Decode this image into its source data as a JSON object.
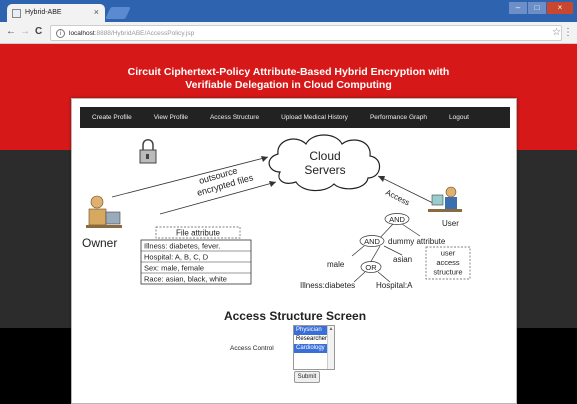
{
  "browser": {
    "tab_title": "Hybrid-ABE",
    "tab_close": "×",
    "url_host": "localhost",
    "url_rest": ":8888/HybridABE/AccessPolicy.jsp",
    "back": "←",
    "forward": "→",
    "reload": "C",
    "info": "i",
    "star": "☆",
    "menu": "⋮",
    "window_buttons": {
      "minimize": "–",
      "maximize": "□",
      "close": "×"
    }
  },
  "header": {
    "title_line1": "Circuit Ciphertext-Policy Attribute-Based Hybrid Encryption with",
    "title_line2": "Verifiable Delegation in Cloud Computing"
  },
  "nav": {
    "items": [
      "Create Profile",
      "View Profile",
      "Access Structure",
      "Upload Medical History",
      "Performance Graph",
      "Logout"
    ]
  },
  "diagram": {
    "cloud_line1": "Cloud",
    "cloud_line2": "Servers",
    "outsource_line1": "outsource",
    "outsource_line2": "encrypted files",
    "owner": "Owner",
    "file_attribute_title": "File attribute",
    "attributes": [
      "Illness: diabetes, fever.",
      "Hospital: A, B, C, D",
      "Sex: male, female",
      "Race: asian, black, white"
    ],
    "access": "Access",
    "user": "User",
    "and": "AND",
    "or": "OR",
    "dummy": "dummy attribute",
    "male": "male",
    "asian": "asian",
    "illness_diabetes": "Illness:diabetes",
    "hospital_a": "Hospital:A",
    "uas_line1": "user",
    "uas_line2": "access",
    "uas_line3": "structure"
  },
  "form": {
    "title": "Access Structure Screen",
    "label": "Access Control",
    "options": [
      "Physician",
      "Researcher",
      "Cardiology"
    ],
    "selected": [
      "Physician",
      "Cardiology"
    ],
    "submit": "Submit"
  },
  "colors": {
    "header_red": "#d71818",
    "nav_bg": "#222222",
    "selected_option": "#3a6fd8",
    "chrome_blue": "#2e63b0"
  }
}
